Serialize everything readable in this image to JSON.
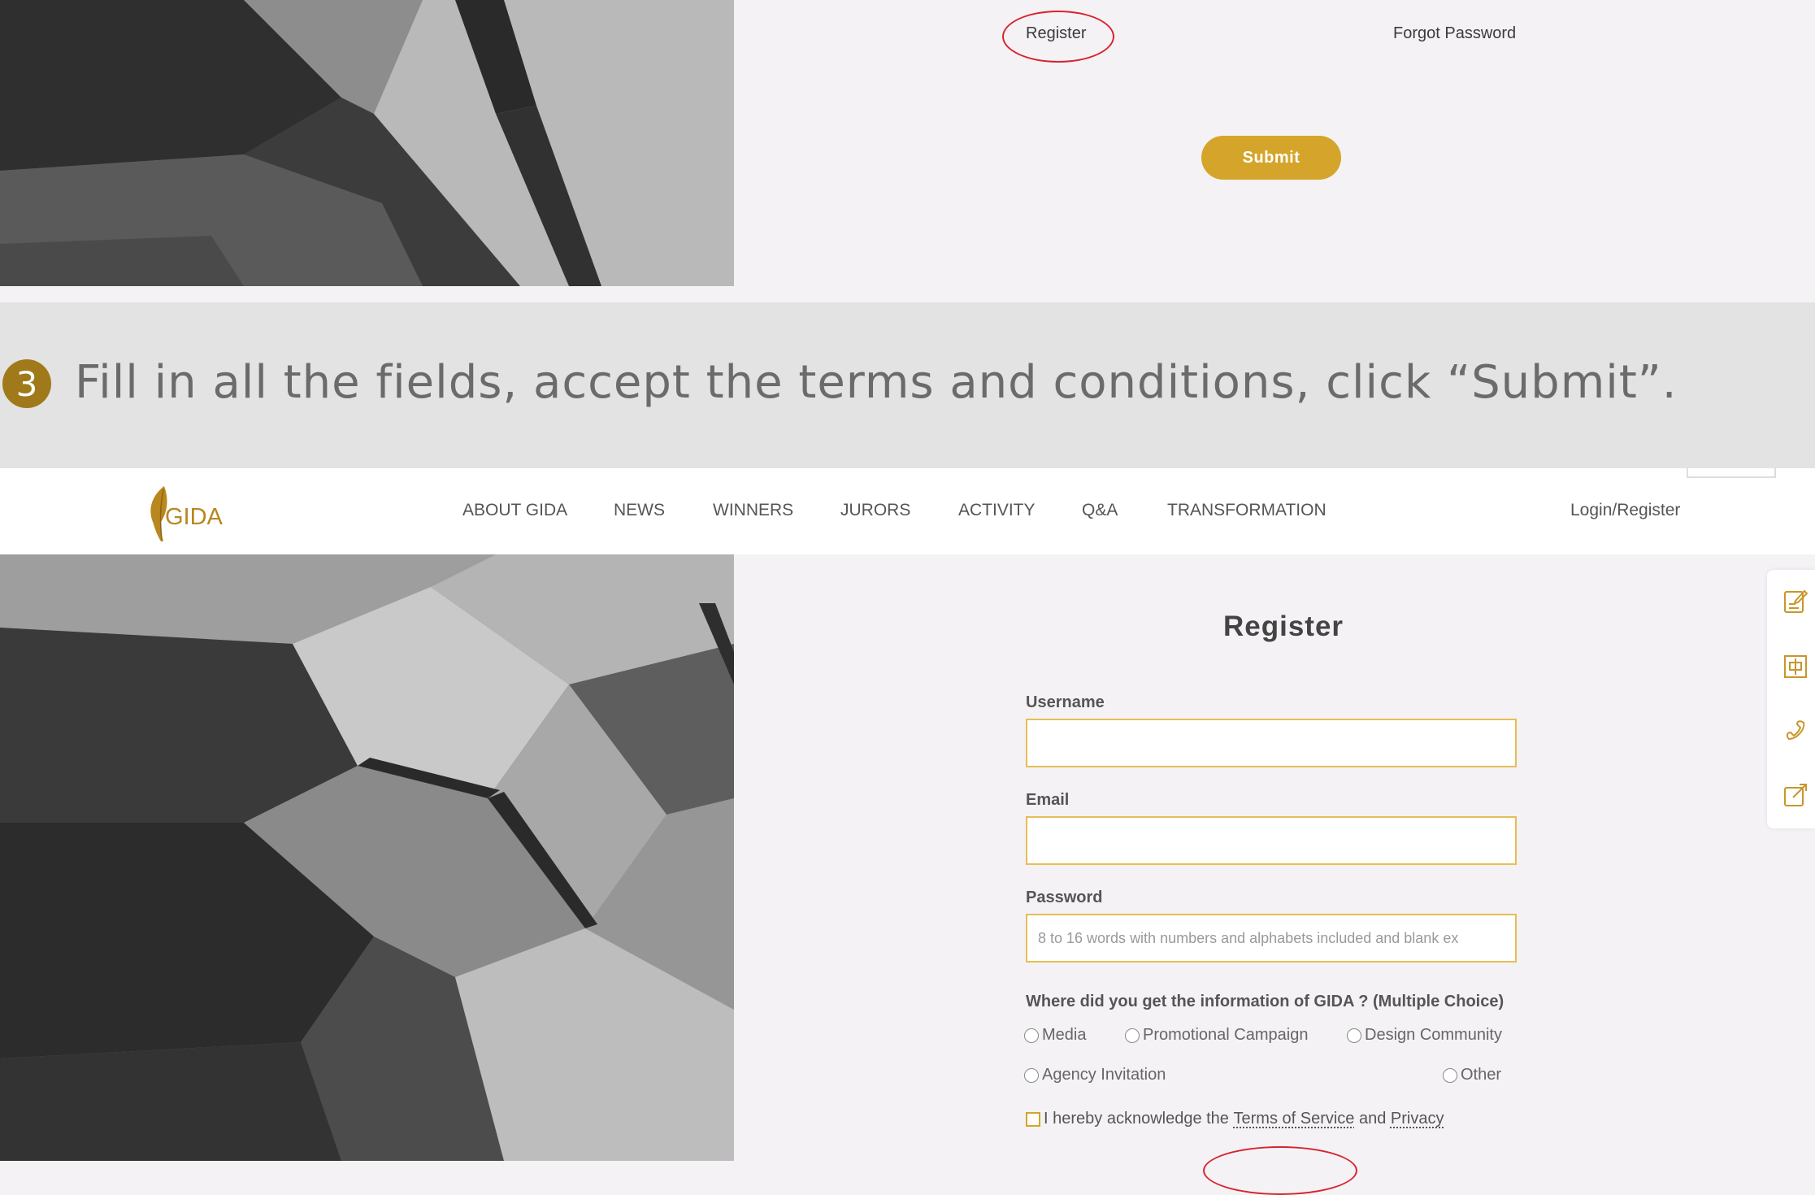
{
  "top": {
    "register_link": "Register",
    "forgot_link": "Forgot Password",
    "submit_label": "Submit"
  },
  "step": {
    "number": "3",
    "instruction": "Fill in all the fields, accept the terms and conditions, click “Submit”."
  },
  "nav": {
    "logo_text": "GIDA",
    "items": [
      "ABOUT GIDA",
      "NEWS",
      "WINNERS",
      "JURORS",
      "ACTIVITY",
      "Q&A",
      "TRANSFORMATION"
    ],
    "login": "Login/Register"
  },
  "form": {
    "title": "Register",
    "username_label": "Username",
    "email_label": "Email",
    "password_label": "Password",
    "password_placeholder": "8 to 16 words with numbers and alphabets included and blank ex",
    "question": "Where did you get the information of GIDA ? (Multiple Choice)",
    "options": [
      "Media",
      "Promotional Campaign",
      "Design Community",
      "Agency Invitation",
      "Other"
    ],
    "terms_prefix": "I hereby acknowledge the ",
    "terms_link": "Terms of Service",
    "terms_and": " and ",
    "privacy_link": "Privacy"
  },
  "side_toolbar": {
    "icons": [
      "edit-note-icon",
      "chinese-language-icon",
      "phone-icon",
      "external-edit-icon"
    ]
  },
  "colors": {
    "accent_gold": "#d4a52a",
    "step_badge": "#a07a1a",
    "highlight_red": "#d6242f",
    "field_border": "#e7bd55"
  }
}
